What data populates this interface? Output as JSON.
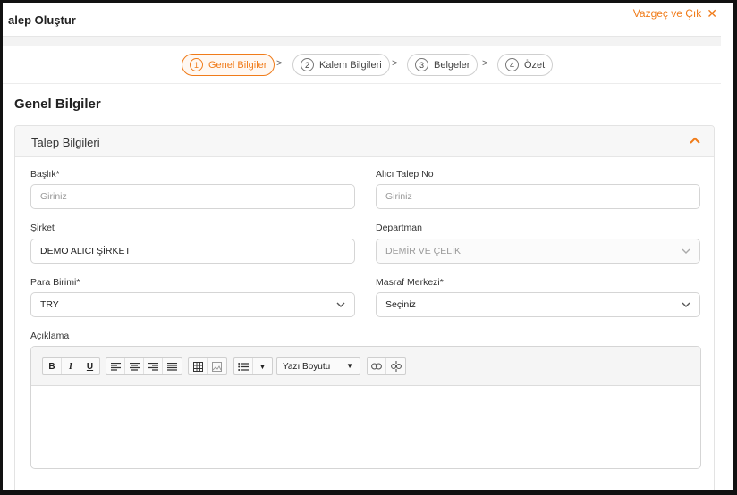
{
  "window": {
    "title": "alep Oluştur",
    "exit_label": "Vazgeç ve Çık",
    "exit_icon": "close-icon"
  },
  "steps": [
    {
      "num": "1",
      "label": "Genel Bilgiler",
      "active": true
    },
    {
      "num": "2",
      "label": "Kalem Bilgileri",
      "active": false
    },
    {
      "num": "3",
      "label": "Belgeler",
      "active": false
    },
    {
      "num": "4",
      "label": "Özet",
      "active": false
    }
  ],
  "section": {
    "title": "Genel Bilgiler"
  },
  "card": {
    "title": "Talep Bilgileri"
  },
  "form": {
    "baslik": {
      "label": "Başlık*",
      "placeholder": "Giriniz",
      "value": ""
    },
    "alici_talep_no": {
      "label": "Alıcı Talep No",
      "placeholder": "Giriniz",
      "value": ""
    },
    "sirket": {
      "label": "Şirket",
      "value": "DEMO ALICI ŞİRKET"
    },
    "departman": {
      "label": "Departman",
      "value": "DEMİR VE ÇELİK"
    },
    "para_birimi": {
      "label": "Para Birimi*",
      "value": "TRY"
    },
    "masraf_merkezi": {
      "label": "Masraf Merkezi*",
      "value": "Seçiniz"
    },
    "aciklama": {
      "label": "Açıklama"
    }
  },
  "editor_toolbar": {
    "bold": "B",
    "italic": "I",
    "underline": "U",
    "font_size_label": "Yazı Boyutu"
  },
  "colors": {
    "accent": "#f07b19",
    "border": "#d5d5d5"
  }
}
